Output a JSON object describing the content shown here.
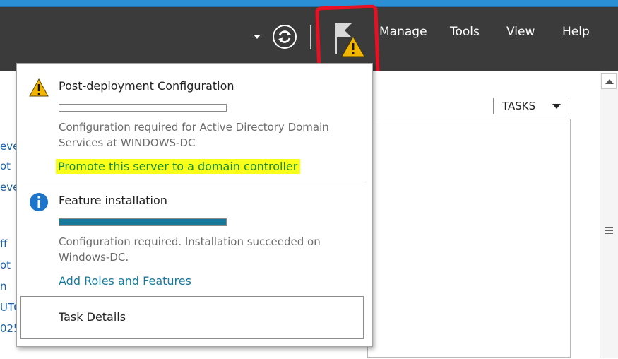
{
  "topbar": {
    "menu": [
      "Manage",
      "Tools",
      "View",
      "Help"
    ]
  },
  "background": {
    "left_fragments": [
      "eve",
      "ot",
      "eve",
      "ff",
      "ot",
      "n",
      "UTC",
      "025"
    ],
    "tasks_label": "TASKS"
  },
  "notifications": [
    {
      "icon": "warning-icon",
      "title": "Post-deployment Configuration",
      "progress": 0,
      "description": "Configuration required for Active Directory Domain Services at WINDOWS-DC",
      "link": "Promote this server to a domain controller"
    },
    {
      "icon": "info-icon",
      "title": "Feature installation",
      "progress": 1.0,
      "description": "Configuration required. Installation succeeded on Windows-DC.",
      "link": "Add Roles and Features"
    }
  ],
  "task_details_label": "Task Details",
  "colors": {
    "topbar": "#3b3b3b",
    "accent_link": "#177a9c",
    "progress_fill": "#177a9c",
    "highlight_box": "#e81123",
    "link_highlight": "#f7ff1a",
    "warning": "#f2b600",
    "info": "#1e74c8"
  }
}
